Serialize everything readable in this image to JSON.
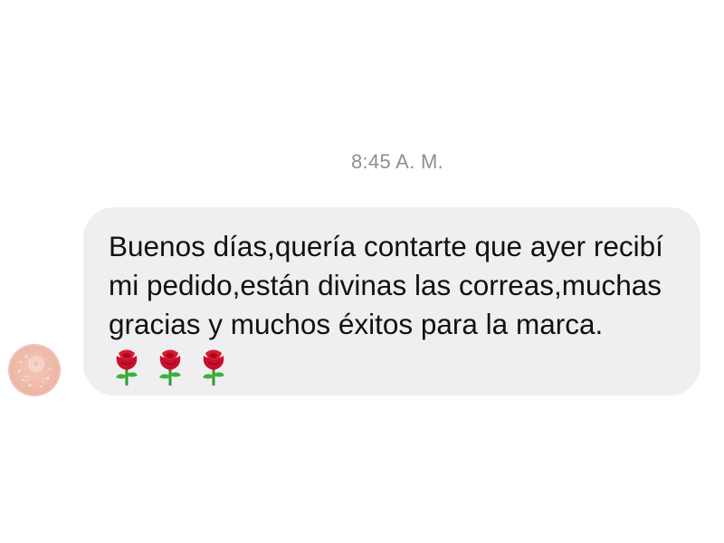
{
  "conversation": {
    "timestamp": "8:45 A. M.",
    "messages": [
      {
        "text": "Buenos días,quería contarte que ayer recibí mi pedido,están divinas las correas,muchas gracias y muchos éxitos para la marca.",
        "emoji": [
          "rose-emoji",
          "rose-emoji",
          "rose-emoji"
        ]
      }
    ]
  },
  "colors": {
    "bubble_background": "#efeff1",
    "timestamp": "#8e8e93",
    "avatar": "#eeb9a8"
  }
}
